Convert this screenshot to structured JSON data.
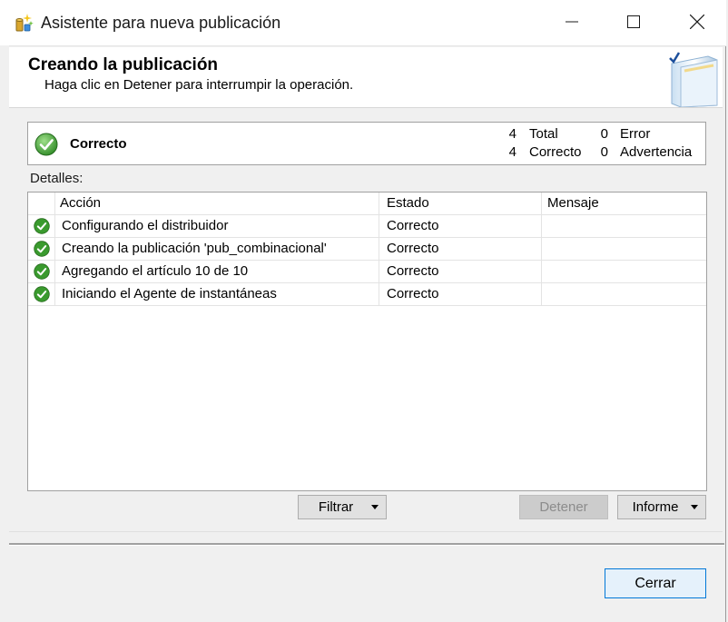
{
  "window": {
    "title": "Asistente para nueva publicación"
  },
  "header": {
    "title": "Creando la publicación",
    "subtitle": "Haga clic en Detener para interrumpir la operación."
  },
  "summary": {
    "status": "Correcto",
    "total_count": "4",
    "total_label": "Total",
    "success_count": "4",
    "success_label": "Correcto",
    "error_count": "0",
    "error_label": "Error",
    "warning_count": "0",
    "warning_label": "Advertencia"
  },
  "details": {
    "label": "Detalles:",
    "columns": [
      "Acción",
      "Estado",
      "Mensaje"
    ],
    "rows": [
      {
        "action": "Configurando el distribuidor",
        "status": "Correcto",
        "message": ""
      },
      {
        "action": "Creando la publicación 'pub_combinacional'",
        "status": "Correcto",
        "message": ""
      },
      {
        "action": "Agregando el artículo 10 de 10",
        "status": "Correcto",
        "message": ""
      },
      {
        "action": "Iniciando el Agente de instantáneas",
        "status": "Correcto",
        "message": ""
      }
    ]
  },
  "buttons": {
    "filter": "Filtrar",
    "stop": "Detener",
    "report": "Informe",
    "close": "Cerrar"
  },
  "icons": {
    "app": "publication-wizard-icon",
    "success": "success-check-icon",
    "header_art": "book-check-icon"
  },
  "colors": {
    "success_green": "#3a9a2e",
    "focus_border": "#0078d7"
  }
}
